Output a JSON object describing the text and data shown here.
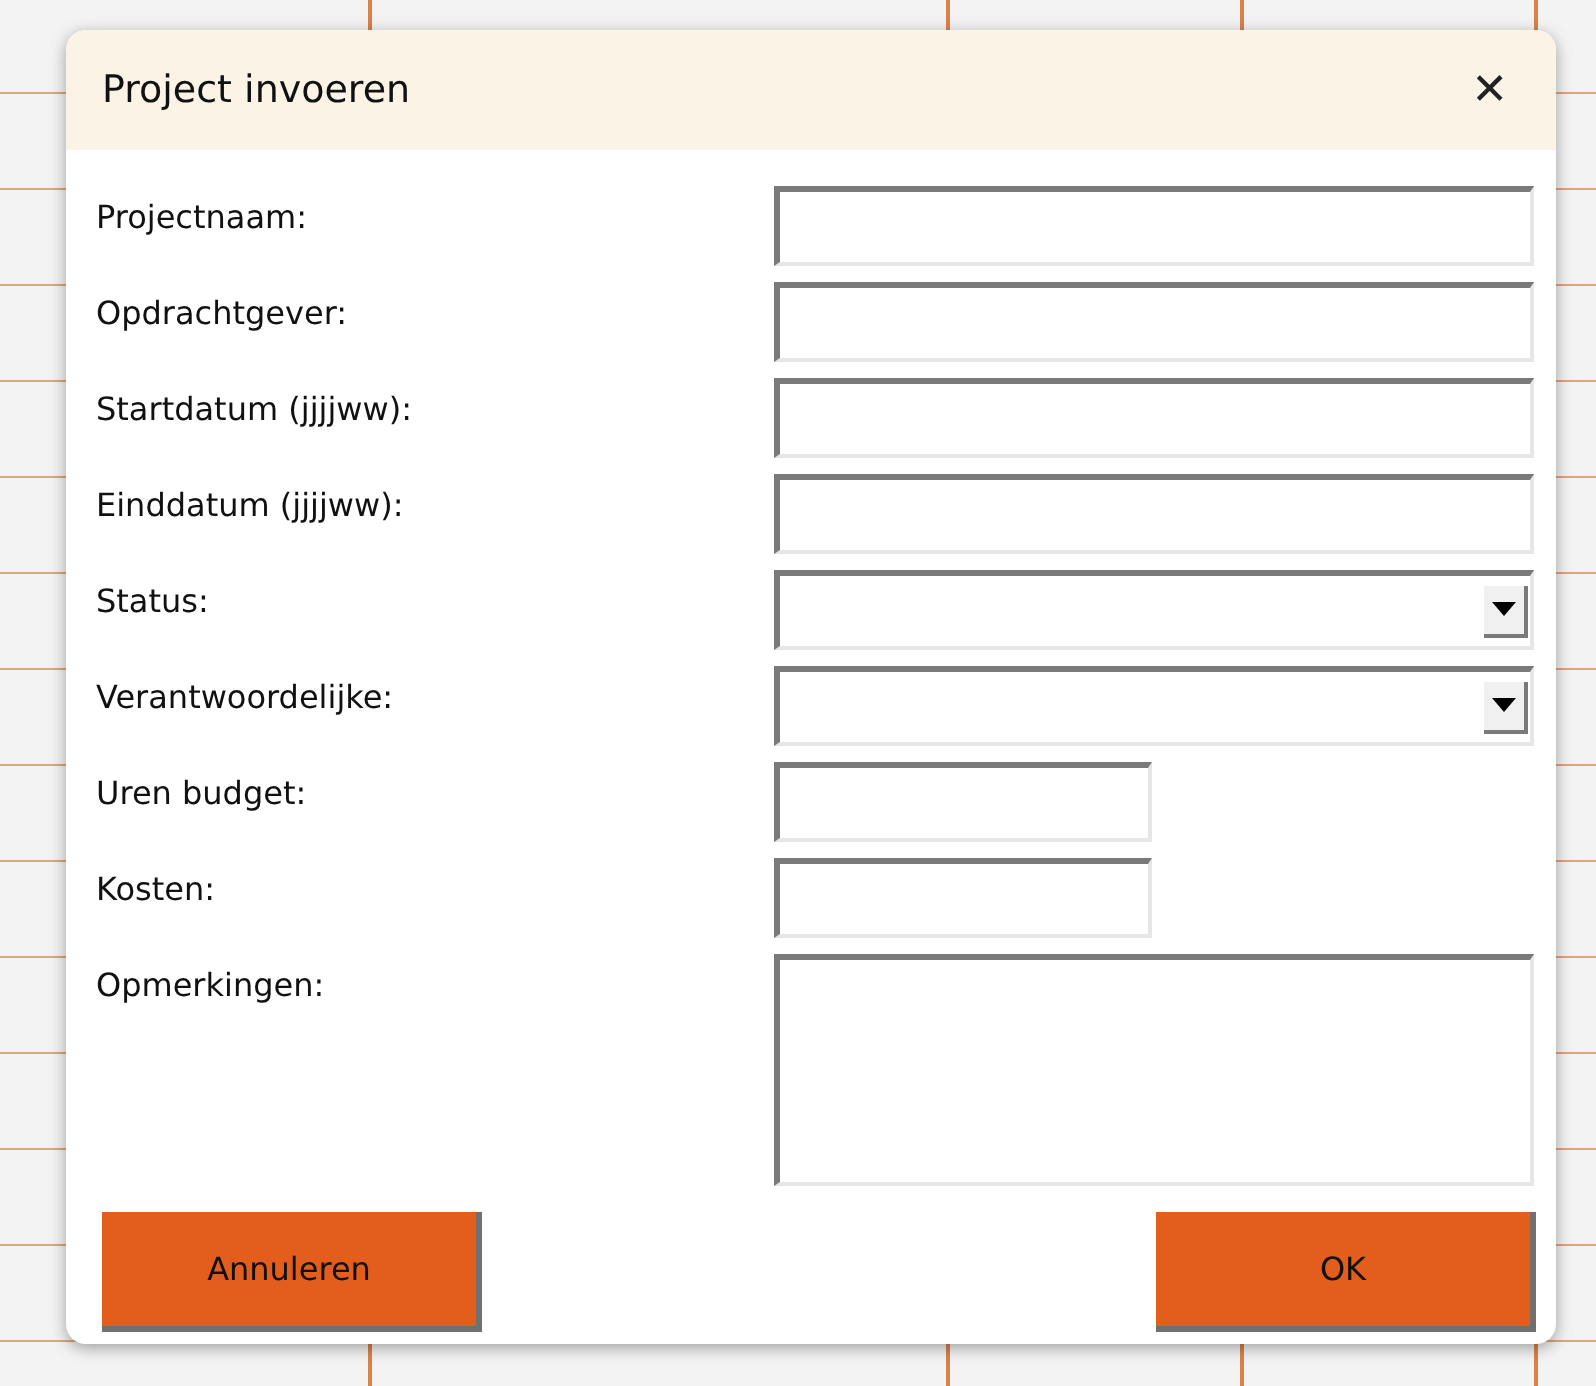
{
  "window": {
    "title": "Project invoeren",
    "close": "✕"
  },
  "fields": [
    {
      "label": "Projectnaam:",
      "kind": "text"
    },
    {
      "label": "Opdrachtgever:",
      "kind": "text"
    },
    {
      "label": "Startdatum (jjjjww):",
      "kind": "text"
    },
    {
      "label": "Einddatum (jjjjww):",
      "kind": "text"
    },
    {
      "label": "Status:",
      "kind": "dropdown"
    },
    {
      "label": "Verantwoordelijke:",
      "kind": "dropdown"
    },
    {
      "label": "Uren budget:",
      "kind": "short"
    },
    {
      "label": "Kosten:",
      "kind": "short"
    },
    {
      "label": "Opmerkingen:",
      "kind": "memo"
    }
  ],
  "buttons": [
    "Annuleren",
    "OK"
  ]
}
